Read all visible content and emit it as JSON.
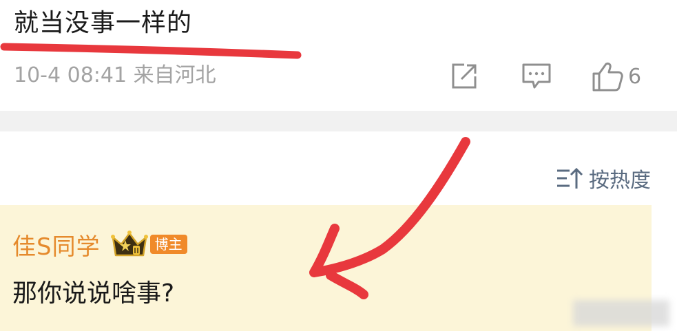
{
  "post": {
    "text": "就当没事一样的",
    "meta": "10-4 08:41 来自河北",
    "like_count": "6",
    "icons": [
      "share-icon",
      "comment-icon",
      "like-icon"
    ]
  },
  "comments": {
    "sort_label": "按热度",
    "sort_icon": "sort-icon",
    "items": [
      {
        "author": "佳S同学",
        "badge": "博主",
        "crown_icon": "crown-icon",
        "text": "那你说说啥事?"
      }
    ]
  },
  "colors": {
    "annotation": "#e8383d",
    "author": "#e58a2c",
    "comment_bg": "#fcf5d8",
    "badge_bg": "#f08a2a",
    "meta_text": "#a3a3a3",
    "sort_text": "#5a6b80"
  },
  "annotations": [
    "red-underline-stroke",
    "red-arrow-stroke"
  ]
}
